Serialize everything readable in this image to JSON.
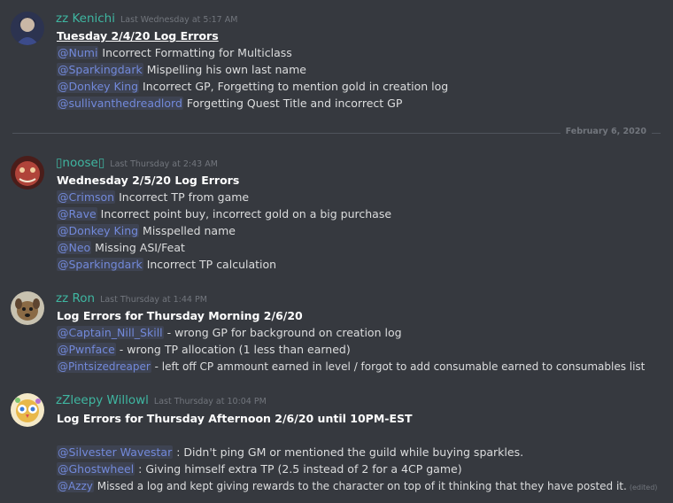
{
  "colors": {
    "background": "#36393f",
    "username": "#3fb6a1",
    "mention": "#7289da",
    "timestamp": "#72767d",
    "text": "#dcddde"
  },
  "date_divider": "February 6, 2020",
  "messages": [
    {
      "author": "zz Kenichi",
      "timestamp": "Last Wednesday at 5:17 AM",
      "avatar_icon": "anime-character-avatar-icon",
      "title": "Tuesday 2/4/20 Log Errors",
      "lines": [
        {
          "mention": "@Numi",
          "text": " Incorrect Formatting for Multiclass"
        },
        {
          "mention": "@Sparkingdark",
          "text": " Mispelling his own last name"
        },
        {
          "mention": "@Donkey King",
          "text": " Incorrect GP, Forgetting to mention gold in creation log"
        },
        {
          "mention": "@sullivanthedreadlord",
          "text": " Forgetting Quest Title and incorrect GP"
        }
      ]
    },
    {
      "author": "▯noose▯",
      "timestamp": "Last Thursday at 2:43 AM",
      "avatar_icon": "red-creature-avatar-icon",
      "title": "Wednesday 2/5/20 Log Errors",
      "lines": [
        {
          "mention": "@Crimson",
          "text": " Incorrect TP from game"
        },
        {
          "mention": "@Rave",
          "text": " Incorrect point buy, incorrect gold on a big purchase"
        },
        {
          "mention": "@Donkey King",
          "text": " Misspelled name"
        },
        {
          "mention": "@Neo",
          "text": " Missing ASI/Feat"
        },
        {
          "mention": "@Sparkingdark",
          "text": " Incorrect TP calculation"
        }
      ]
    },
    {
      "author": "zz Ron",
      "timestamp": "Last Thursday at 1:44 PM",
      "avatar_icon": "dog-avatar-icon",
      "title": "Log Errors for Thursday Morning 2/6/20",
      "lines": [
        {
          "mention": "@Captain_Nill_Skill",
          "text": " - wrong GP for background on creation log"
        },
        {
          "mention": "@Pwnface",
          "text": " - wrong TP allocation (1 less than earned)"
        },
        {
          "mention": "@Pintsizedreaper",
          "text": " - left off CP ammount earned in level / forgot to add consumable earned to consumables list"
        }
      ]
    },
    {
      "author": "zZleepy Willowl",
      "timestamp": "Last Thursday at 10:04 PM",
      "avatar_icon": "colorful-owl-avatar-icon",
      "title": "Log Errors for Thursday Afternoon 2/6/20 until 10PM-EST",
      "lines": [
        {
          "mention": "@Silvester Wavestar",
          "text": " : Didn't ping GM or mentioned the guild while buying sparkles."
        },
        {
          "mention": "@Ghostwheel",
          "text": " : Giving himself extra TP (2.5 instead of 2 for a 4CP game)"
        },
        {
          "mention": "@Azzy",
          "text": " Missed a log and kept giving rewards to the character on top of it thinking that they have posted it.",
          "edited": "(edited)"
        }
      ]
    }
  ]
}
